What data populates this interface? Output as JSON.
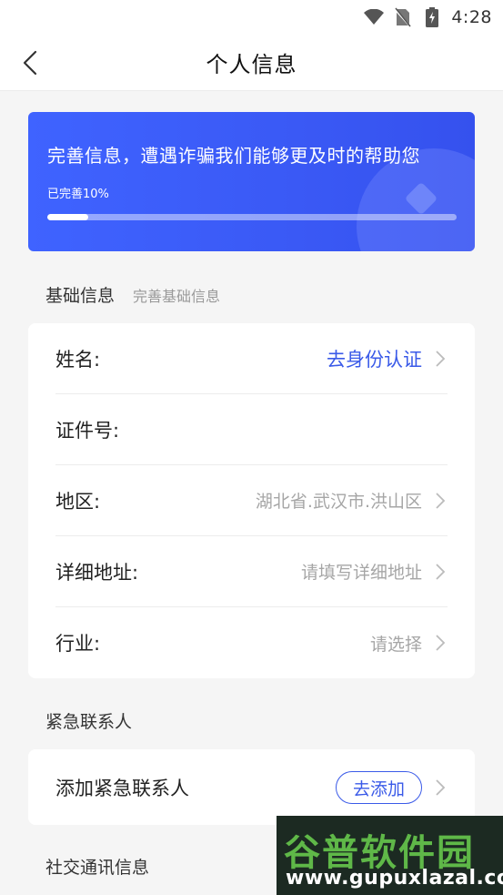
{
  "status_bar": {
    "time": "4:28"
  },
  "header": {
    "title": "个人信息"
  },
  "banner": {
    "text": "完善信息，遭遇诈骗我们能够更及时的帮助您",
    "progress_label": "已完善10%",
    "progress_fraction": 0.1
  },
  "basic_section": {
    "title": "基础信息",
    "subtitle": "完善基础信息",
    "rows": [
      {
        "label": "姓名:",
        "value": "去身份认证"
      },
      {
        "label": "证件号:",
        "value": ""
      },
      {
        "label": "地区:",
        "value": "湖北省.武汉市.洪山区"
      },
      {
        "label": "详细地址:",
        "value": "请填写详细地址"
      },
      {
        "label": "行业:",
        "value": "请选择"
      }
    ]
  },
  "emergency_section": {
    "title": "紧急联系人",
    "row_label": "添加紧急联系人",
    "add_label": "去添加"
  },
  "social_section": {
    "title": "社交通讯信息"
  },
  "watermark": {
    "title": "谷普软件园",
    "url": "www.gupuxlazal.com"
  },
  "colors": {
    "accent": "#3a5ae8",
    "banner": "#3f63ff"
  }
}
